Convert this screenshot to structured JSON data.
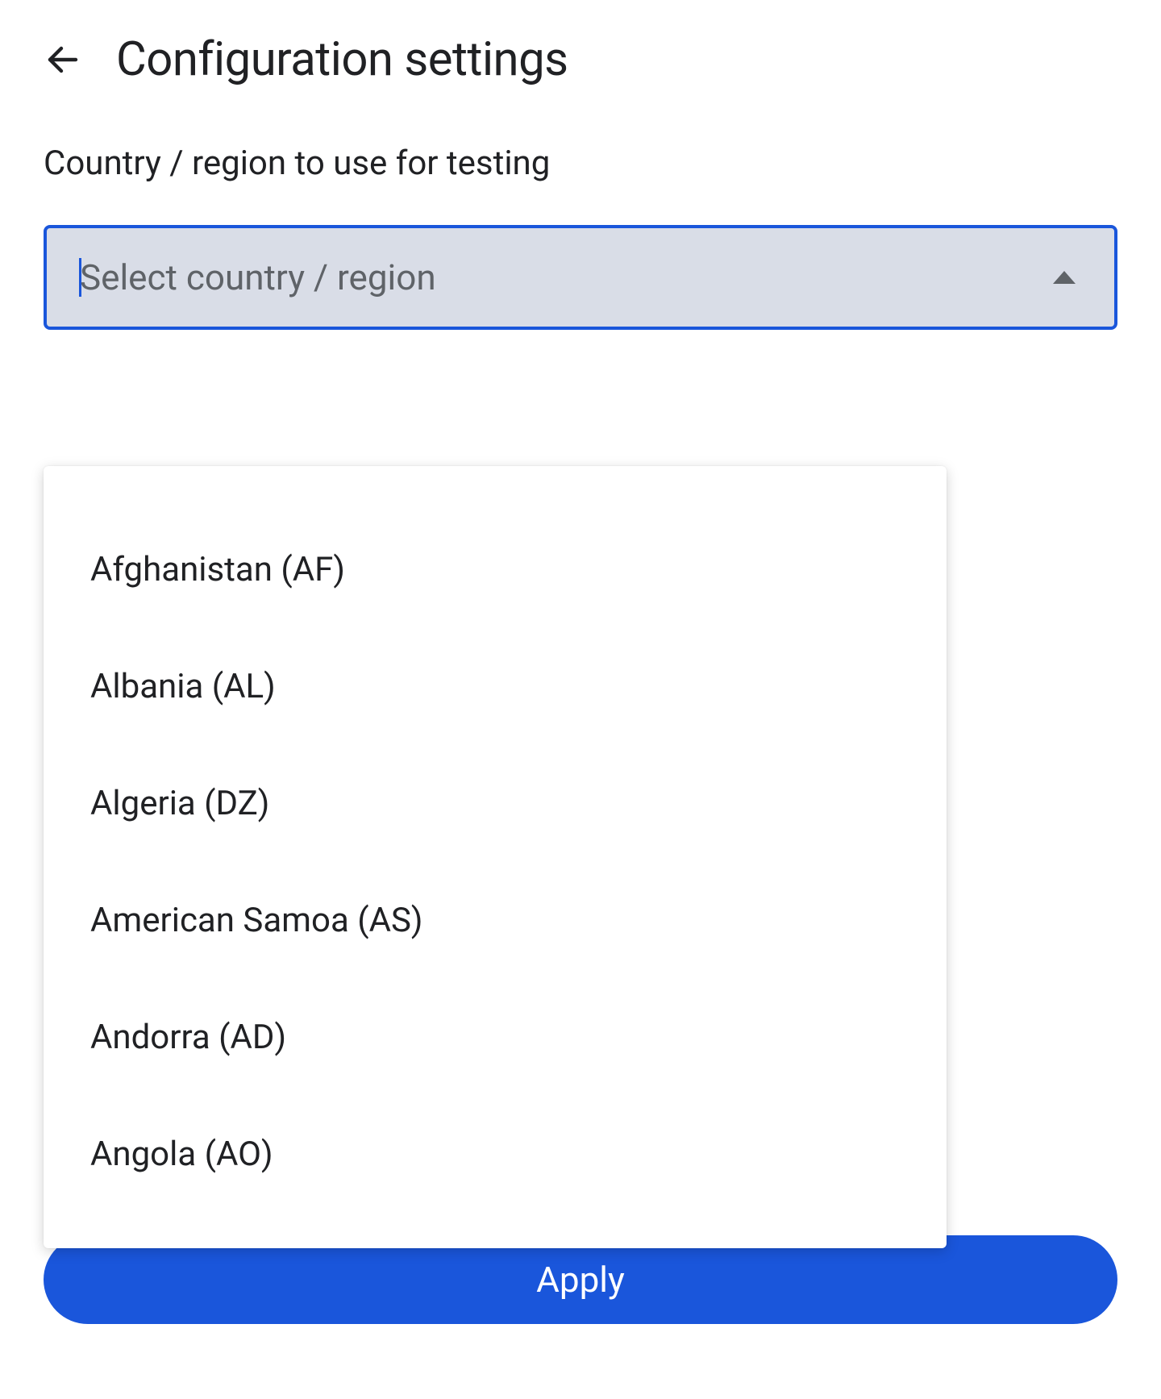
{
  "header": {
    "title": "Configuration settings"
  },
  "form": {
    "country_label": "Country / region to use for testing",
    "select_placeholder": "Select country / region",
    "apply_label": "Apply"
  },
  "dropdown": {
    "options": [
      "Afghanistan (AF)",
      "Albania (AL)",
      "Algeria (DZ)",
      "American Samoa (AS)",
      "Andorra (AD)",
      "Angola (AO)"
    ]
  }
}
